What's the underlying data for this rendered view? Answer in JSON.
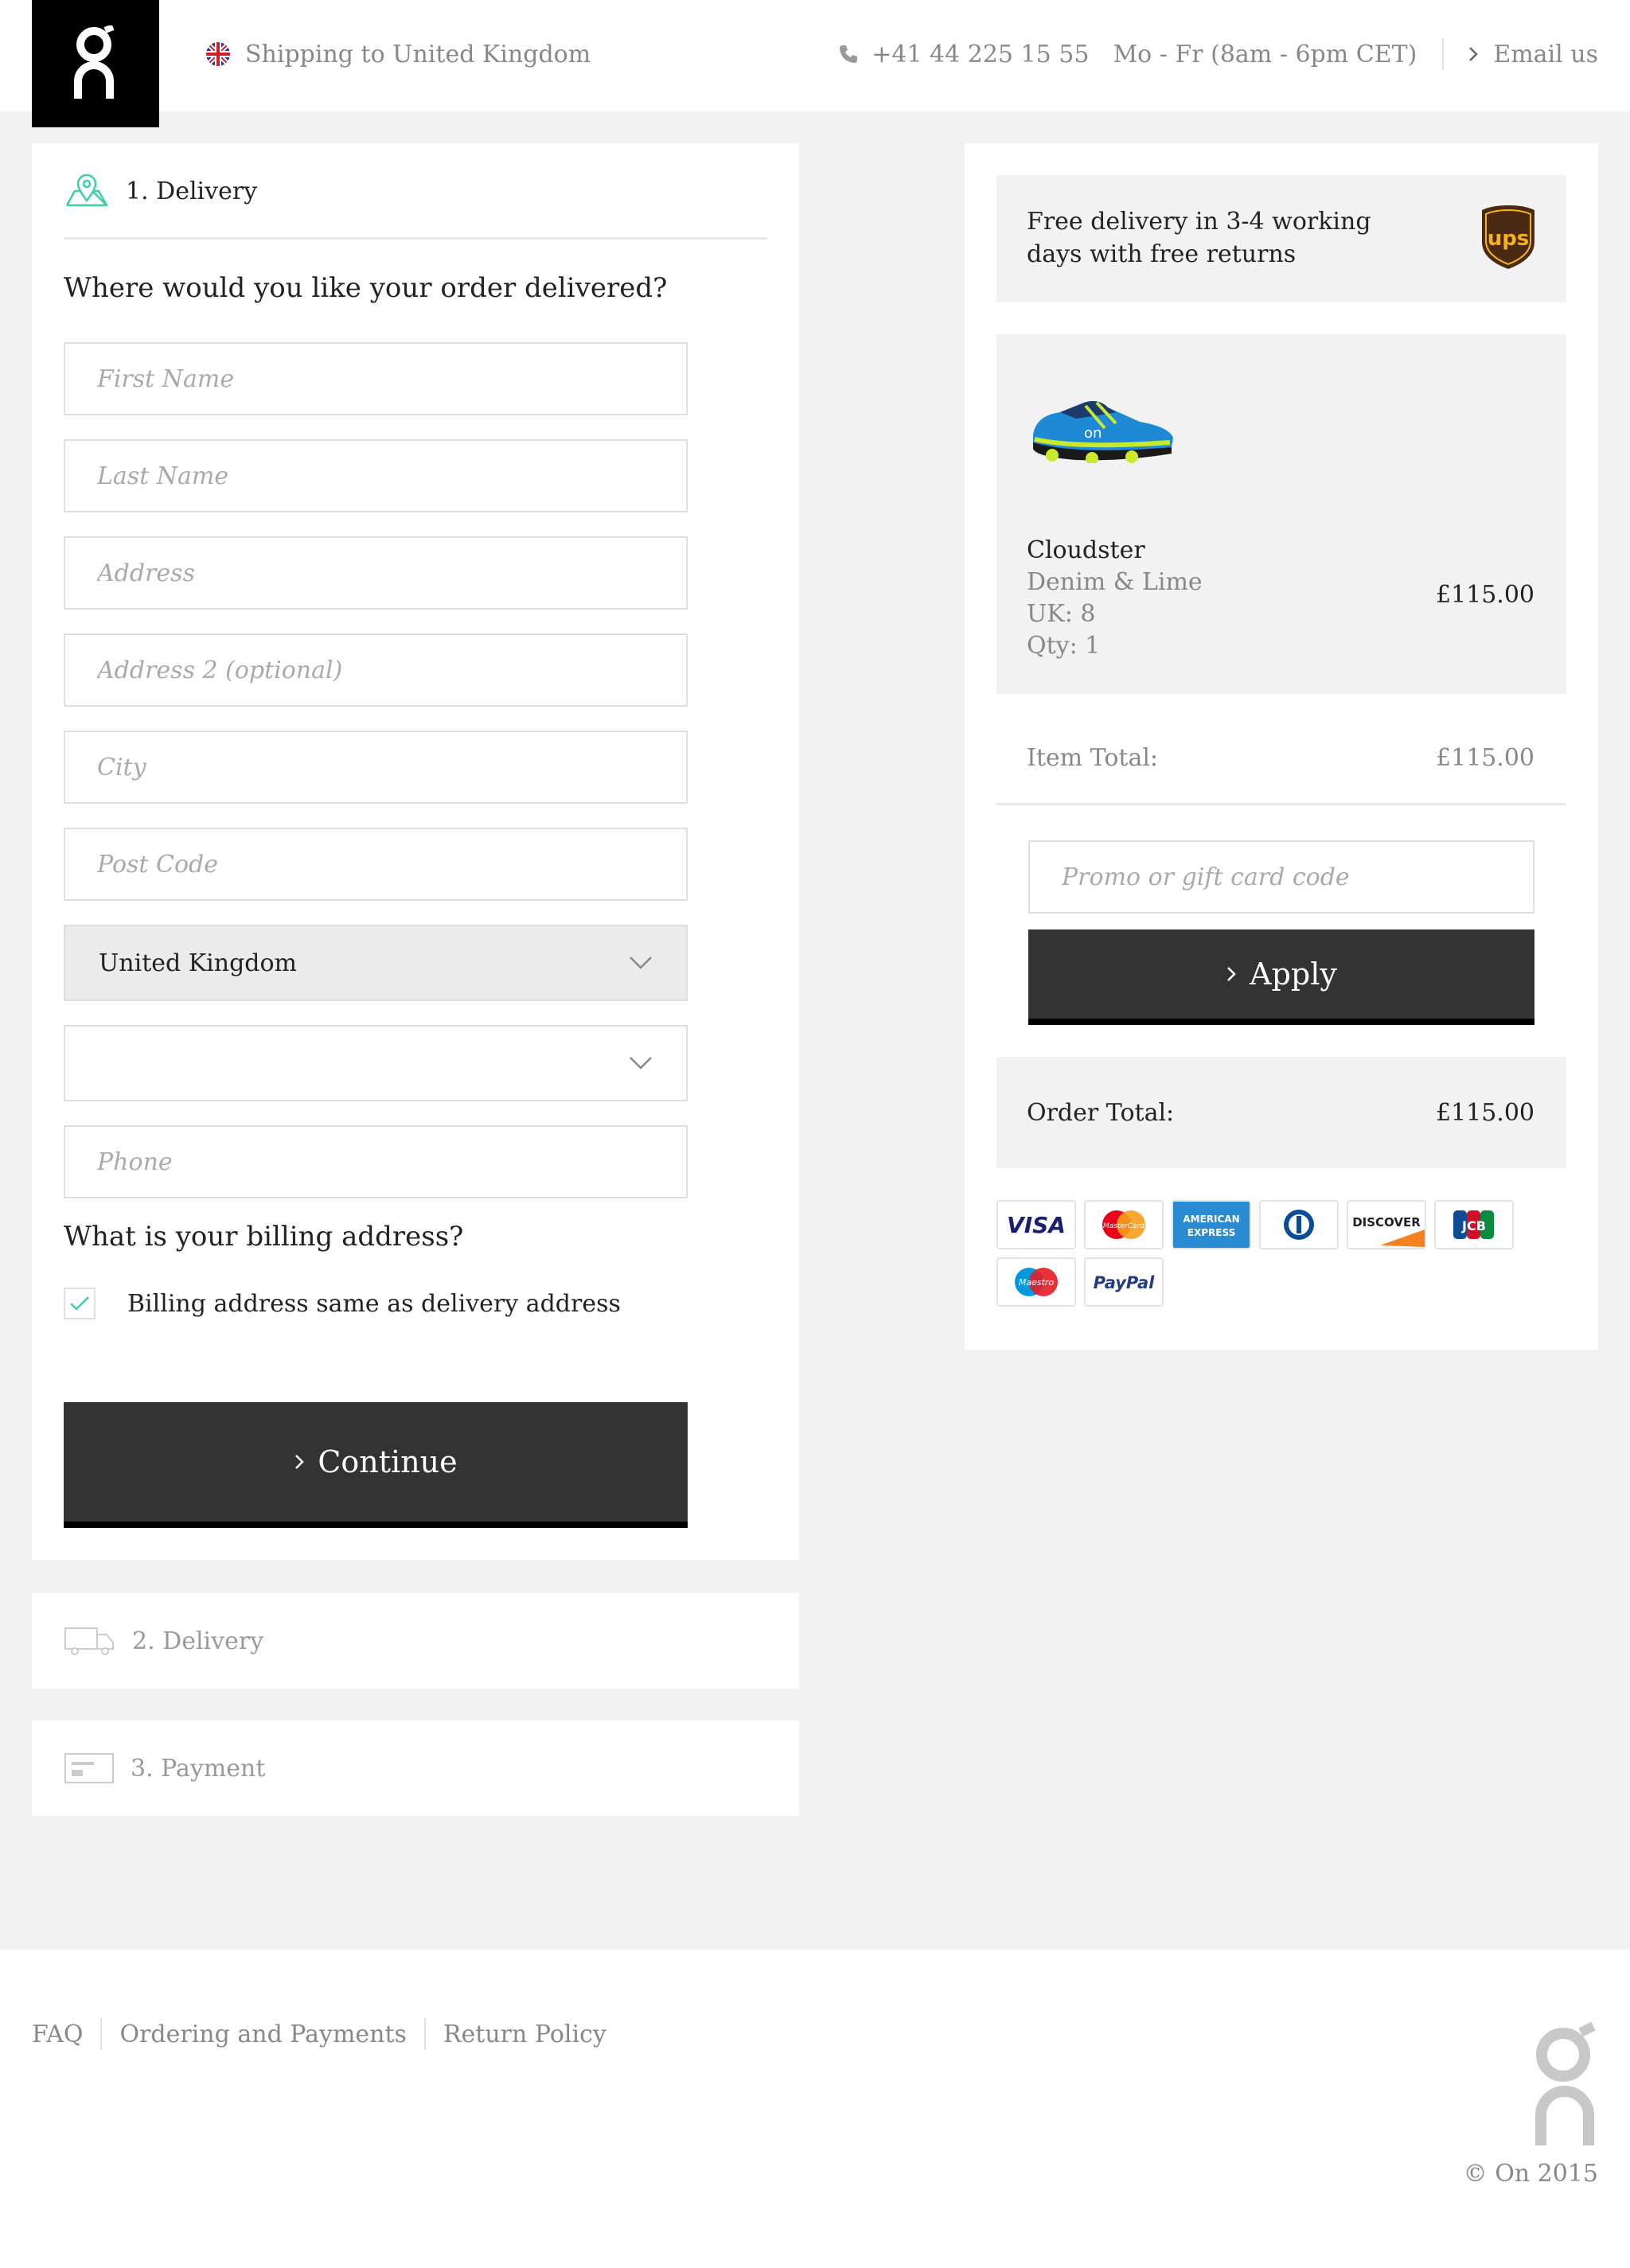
{
  "header": {
    "logo_alt": "On",
    "shipping_text": "Shipping to United Kingdom",
    "phone": "+41 44 225 15 55",
    "hours": "Mo - Fr (8am - 6pm CET)",
    "email_label": "Email us"
  },
  "checkout": {
    "step1_label": "1. Delivery",
    "delivery_question": "Where would you like your order delivered?",
    "fields": {
      "first_name": "First Name",
      "last_name": "Last Name",
      "address": "Address",
      "address2": "Address 2 (optional)",
      "city": "City",
      "post_code": "Post Code",
      "phone": "Phone"
    },
    "country_value": "United Kingdom",
    "region_value": "",
    "billing_question": "What is your billing address?",
    "billing_same_label": "Billing address same as delivery address",
    "billing_same_checked": true,
    "continue_label": "Continue",
    "step2_label": "2. Delivery",
    "step3_label": "3. Payment"
  },
  "summary": {
    "shipping_note": "Free delivery in 3-4 working days with free returns",
    "product": {
      "name": "Cloudster",
      "color": "Denim & Lime",
      "size": "UK: 8",
      "qty": "Qty: 1",
      "price": "£115.00"
    },
    "item_total_label": "Item Total:",
    "item_total_value": "£115.00",
    "promo_placeholder": "Promo or gift card code",
    "apply_label": "Apply",
    "order_total_label": "Order Total:",
    "order_total_value": "£115.00",
    "payment_methods": [
      "VISA",
      "MasterCard",
      "AMERICAN EXPRESS",
      "Diners Club",
      "DISCOVER",
      "JCB",
      "Maestro",
      "PayPal"
    ]
  },
  "footer": {
    "links": [
      "FAQ",
      "Ordering and Payments",
      "Return Policy"
    ],
    "copyright": "© On 2015"
  },
  "colors": {
    "accent_green": "#3ecfa4",
    "button_dark": "#333333",
    "page_bg": "#f2f2f2"
  }
}
